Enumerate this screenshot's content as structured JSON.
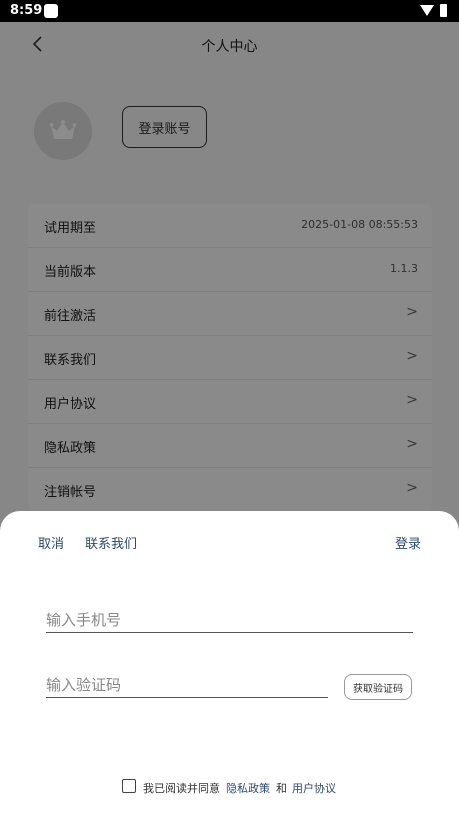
{
  "status_bar": {
    "time": "8:59"
  },
  "header": {
    "title": "个人中心"
  },
  "profile": {
    "login_button": "登录账号"
  },
  "list": [
    {
      "label": "试用期至",
      "value": "2025-01-08 08:55:53"
    },
    {
      "label": "当前版本",
      "value": "1.1.3"
    },
    {
      "label": "前往激活",
      "value": ">"
    },
    {
      "label": "联系我们",
      "value": ">"
    },
    {
      "label": "用户协议",
      "value": ">"
    },
    {
      "label": "隐私政策",
      "value": ">"
    },
    {
      "label": "注销帐号",
      "value": ">"
    }
  ],
  "login_sheet": {
    "cancel": "取消",
    "contact": "联系我们",
    "login": "登录",
    "phone_placeholder": "输入手机号",
    "code_placeholder": "输入验证码",
    "get_code": "获取验证码",
    "agree_text": "我已阅读并同意",
    "privacy_link": "隐私政策",
    "and_text": "和",
    "terms_link": "用户协议"
  },
  "colors": {
    "accent": "#2d4a6b",
    "overlay": "rgba(0,0,0,0.45)"
  }
}
